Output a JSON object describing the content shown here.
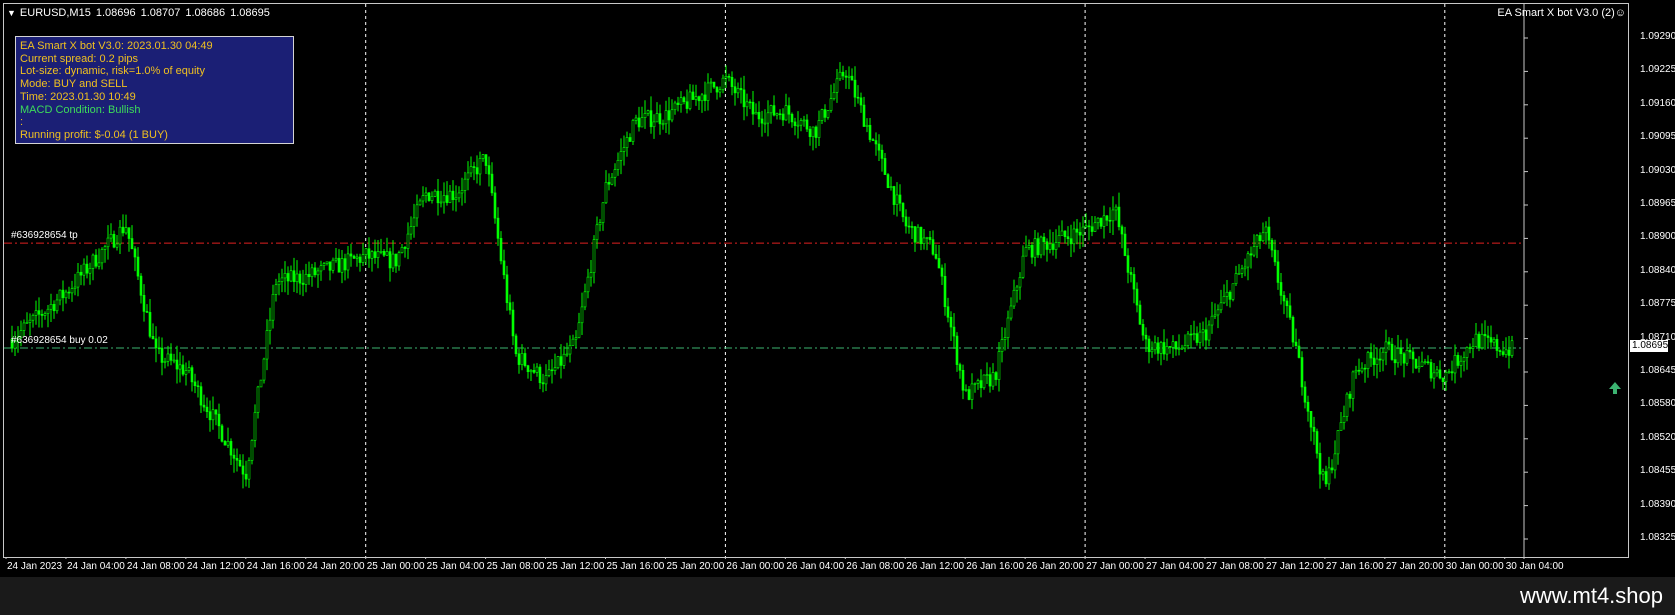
{
  "title_bar": {
    "symbol": "EURUSD,M15",
    "open": "1.08696",
    "high": "1.08707",
    "low": "1.08686",
    "close": "1.08695"
  },
  "ea_label": "EA Smart X bot V3.0 (2)☺",
  "info_panel": {
    "lines": [
      {
        "text": "EA Smart X bot V3.0: 2023.01.30 04:49",
        "color": "#f0c020"
      },
      {
        "text": "Current spread: 0.2 pips",
        "color": "#f0c020"
      },
      {
        "text": "Lot-size: dynamic, risk=1.0% of equity",
        "color": "#f0c020"
      },
      {
        "text": "Mode: BUY and SELL",
        "color": "#f0c020"
      },
      {
        "text": "Time: 2023.01.30 10:49",
        "color": "#f0c020"
      },
      {
        "text": "MACD Condition: Bullish",
        "color": "#3ddc5a"
      },
      {
        "text": ":",
        "color": "#f0c020"
      },
      {
        "text": "Running profit: $-0.04 (1 BUY)",
        "color": "#f0c020"
      }
    ]
  },
  "line_labels": {
    "tp": "#636928654 tp",
    "buy": "#636928654 buy 0.02"
  },
  "current_price": "1.08695",
  "footer_text": "www.mt4.shop",
  "colors": {
    "candle": "#00ff00",
    "tp_line": "#e02020",
    "buy_line": "#3cb371",
    "session_separator": "#ffffff"
  },
  "chart_data": {
    "type": "candlestick",
    "y_tick_labels": [
      "1.09290",
      "1.09225",
      "1.09160",
      "1.09095",
      "1.09030",
      "1.08965",
      "1.08900",
      "1.08840",
      "1.08775",
      "1.08710",
      "1.08645",
      "1.08580",
      "1.08520",
      "1.08455",
      "1.08390",
      "1.08325"
    ],
    "ylim": [
      1.0831,
      1.0932
    ],
    "x_tick_labels": [
      "24 Jan 2023",
      "24 Jan 04:00",
      "24 Jan 08:00",
      "24 Jan 12:00",
      "24 Jan 16:00",
      "24 Jan 20:00",
      "25 Jan 00:00",
      "25 Jan 04:00",
      "25 Jan 08:00",
      "25 Jan 12:00",
      "25 Jan 16:00",
      "25 Jan 20:00",
      "26 Jan 00:00",
      "26 Jan 04:00",
      "26 Jan 08:00",
      "26 Jan 12:00",
      "26 Jan 16:00",
      "26 Jan 20:00",
      "27 Jan 00:00",
      "27 Jan 04:00",
      "27 Jan 08:00",
      "27 Jan 12:00",
      "27 Jan 16:00",
      "27 Jan 20:00",
      "30 Jan 00:00",
      "30 Jan 04:00"
    ],
    "tp_level": 1.08895,
    "buy_level": 1.08693,
    "current_price": 1.08695,
    "day_separators": [
      "25 Jan 00:00",
      "26 Jan 00:00",
      "27 Jan 00:00",
      "30 Jan 00:00"
    ],
    "price_path": {
      "x": [
        "24 Jan 2023",
        "24 Jan 04:00",
        "24 Jan 08:00",
        "24 Jan 10:00",
        "24 Jan 12:00",
        "24 Jan 16:00",
        "24 Jan 18:00",
        "24 Jan 20:00",
        "25 Jan 00:00",
        "25 Jan 02:00",
        "25 Jan 04:00",
        "25 Jan 06:00",
        "25 Jan 08:00",
        "25 Jan 10:00",
        "25 Jan 12:00",
        "25 Jan 14:00",
        "25 Jan 16:00",
        "25 Jan 18:00",
        "25 Jan 20:00",
        "26 Jan 00:00",
        "26 Jan 02:00",
        "26 Jan 04:00",
        "26 Jan 06:00",
        "26 Jan 08:00",
        "26 Jan 10:00",
        "26 Jan 12:00",
        "26 Jan 14:00",
        "26 Jan 16:00",
        "26 Jan 18:00",
        "26 Jan 20:00",
        "27 Jan 00:00",
        "27 Jan 02:00",
        "27 Jan 04:00",
        "27 Jan 06:00",
        "27 Jan 08:00",
        "27 Jan 12:00",
        "27 Jan 14:00",
        "27 Jan 16:00",
        "27 Jan 18:00",
        "27 Jan 20:00",
        "30 Jan 00:00",
        "30 Jan 02:00",
        "30 Jan 04:00"
      ],
      "close": [
        1.087,
        1.088,
        1.0893,
        1.0868,
        1.0865,
        1.0845,
        1.0882,
        1.0883,
        1.0887,
        1.0886,
        1.0899,
        1.0899,
        1.0906,
        1.0868,
        1.0863,
        1.087,
        1.09,
        1.0913,
        1.0914,
        1.0921,
        1.0914,
        1.0915,
        1.0911,
        1.0923,
        1.0908,
        1.0893,
        1.0888,
        1.086,
        1.0864,
        1.0888,
        1.0892,
        1.0896,
        1.087,
        1.0869,
        1.0872,
        1.0892,
        1.087,
        1.0842,
        1.0865,
        1.0869,
        1.0864,
        1.0871,
        1.0869
      ]
    }
  }
}
